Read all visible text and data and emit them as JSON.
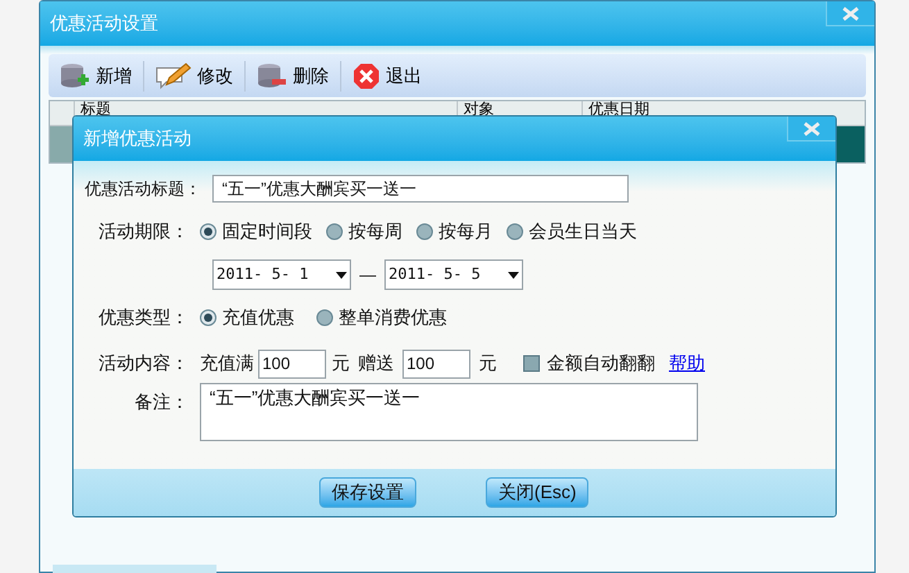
{
  "window": {
    "title": "优惠活动设置"
  },
  "toolbar": [
    {
      "kind": "add",
      "label": "新增"
    },
    {
      "kind": "edit",
      "label": "修改"
    },
    {
      "kind": "delete",
      "label": "删除"
    },
    {
      "kind": "exit",
      "label": "退出"
    }
  ],
  "table": {
    "columns": [
      "标题",
      "对象",
      "优惠日期"
    ]
  },
  "dialog": {
    "title": "新增优惠活动",
    "title_label": "优惠活动标题：",
    "title_value": "“五一”优惠大酬宾买一送一",
    "period_label": "活动期限：",
    "period_options": [
      {
        "label": "固定时间段",
        "selected": true
      },
      {
        "label": "按每周",
        "selected": false
      },
      {
        "label": "按每月",
        "selected": false
      },
      {
        "label": "会员生日当天",
        "selected": false
      }
    ],
    "date_from": "2011- 5- 1",
    "date_separator": "—",
    "date_to": "2011- 5- 5",
    "type_label": "优惠类型：",
    "type_options": [
      {
        "label": "充值优惠",
        "selected": true
      },
      {
        "label": "整单消费优惠",
        "selected": false
      }
    ],
    "content_label": "活动内容：",
    "content_prefix": "充值满",
    "recharge_amount": "100",
    "unit_1": "元",
    "gift_label": "赠送",
    "gift_amount": "100",
    "unit_2": "元",
    "auto_double": {
      "label": "金额自动翻翻",
      "checked": false
    },
    "help_link": "帮助",
    "remarks_label": "备注：",
    "remarks_value": "“五一”优惠大酬宾买一送一",
    "buttons": [
      "保存设置",
      "关闭(Esc)"
    ]
  }
}
